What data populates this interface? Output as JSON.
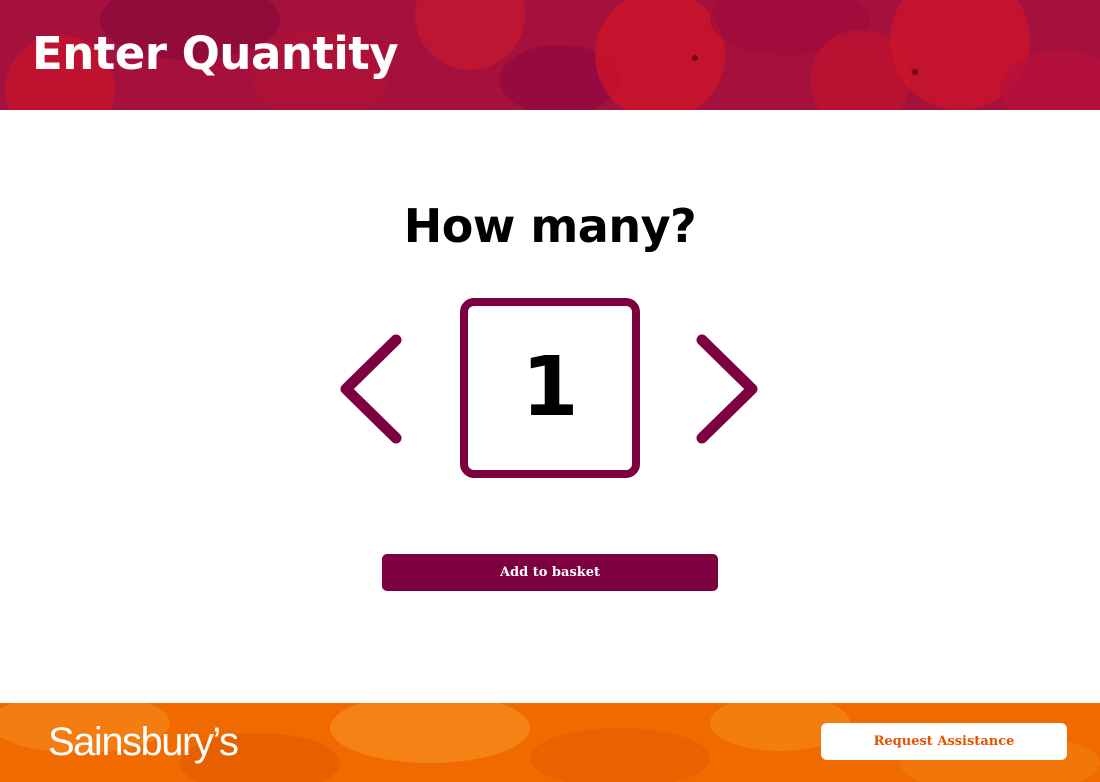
{
  "header": {
    "title": "Enter Quantity",
    "background_color": "#a0103a"
  },
  "main": {
    "question": "How many?",
    "quantity": "1",
    "decrease_icon": "chevron-left-icon",
    "increase_icon": "chevron-right-icon",
    "add_button_label": "Add to basket",
    "accent_color": "#7d0040"
  },
  "footer": {
    "brand": "Sainsbury’s",
    "assist_button_label": "Request Assistance",
    "background_color": "#f06c00",
    "assist_text_color": "#e55300"
  }
}
